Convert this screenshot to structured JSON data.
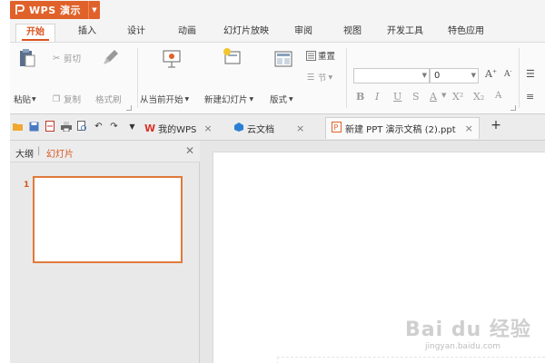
{
  "app": {
    "title": "WPS 演示",
    "accent": "#e0622a"
  },
  "menu": {
    "tabs": [
      "开始",
      "插入",
      "设计",
      "动画",
      "幻灯片放映",
      "审阅",
      "视图",
      "开发工具",
      "特色应用"
    ],
    "active": "开始"
  },
  "ribbon": {
    "paste": "粘贴",
    "cut": "剪切",
    "copy": "复制",
    "format_painter": "格式刷",
    "play_from_current": "从当前开始",
    "new_slide": "新建幻灯片",
    "layout": "版式",
    "reset": "重置",
    "section": "节",
    "font_size_value": "0",
    "bold": "B",
    "italic": "I",
    "underline": "U",
    "strike": "S",
    "font_color": "A",
    "superscript": "X²",
    "subscript": "X₂",
    "grow_font": "A",
    "shrink_font": "A"
  },
  "doc_tabs": [
    {
      "label": "我的WPS",
      "icon": "wps-w-icon"
    },
    {
      "label": "云文档",
      "icon": "cloud-icon"
    },
    {
      "label": "新建 PPT 演示文稿 (2).ppt",
      "icon": "ppt-file-icon",
      "active": true
    }
  ],
  "left_panel": {
    "outline_tab": "大纲",
    "slides_tab": "幻灯片",
    "separator": "|",
    "slide_number": "1"
  },
  "watermark": {
    "brand": "Bai du 经验",
    "url": "jingyan.baidu.com"
  }
}
